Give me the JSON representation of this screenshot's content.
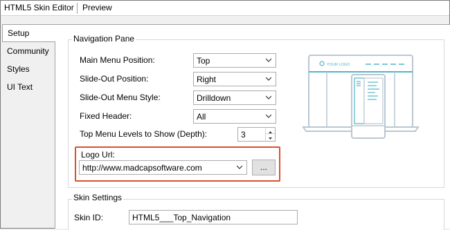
{
  "titlebar": {
    "editor_tab": "HTML5 Skin Editor",
    "preview_tab": "Preview"
  },
  "side_tabs": [
    {
      "label": "Setup",
      "active": true
    },
    {
      "label": "Community"
    },
    {
      "label": "Styles"
    },
    {
      "label": "UI Text"
    }
  ],
  "navigation_pane": {
    "title": "Navigation Pane",
    "main_menu_position": {
      "label": "Main Menu Position:",
      "value": "Top"
    },
    "slide_out_position": {
      "label": "Slide-Out Position:",
      "value": "Right"
    },
    "slide_out_menu_style": {
      "label": "Slide-Out Menu Style:",
      "value": "Drilldown"
    },
    "fixed_header": {
      "label": "Fixed Header:",
      "value": "All"
    },
    "top_menu_levels": {
      "label": "Top Menu Levels to Show (Depth):",
      "value": "3"
    },
    "logo_url": {
      "label": "Logo Url:",
      "value": "http://www.madcapsoftware.com",
      "browse_label": "..."
    },
    "preview_logo_text": "YOUR LOGO"
  },
  "skin_settings": {
    "title": "Skin Settings",
    "skin_id": {
      "label": "Skin ID:",
      "value": "HTML5___Top_Navigation"
    }
  },
  "colors": {
    "accent": "#4fb6c9",
    "highlight_border": "#d9512c",
    "preview_stroke": "#b9c7d1"
  }
}
